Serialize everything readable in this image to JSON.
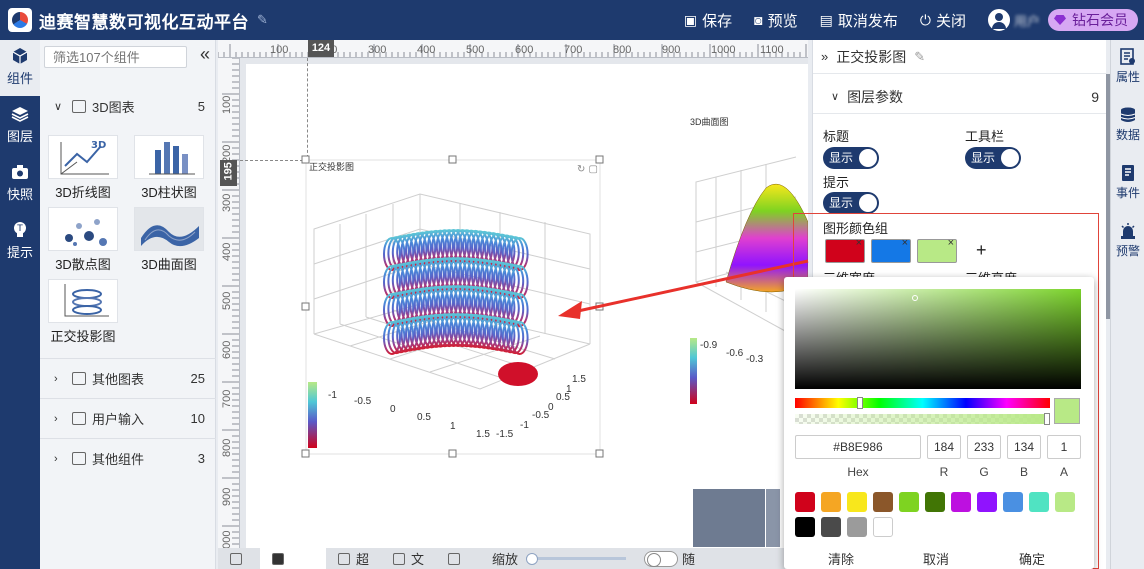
{
  "app": {
    "title": "迪赛智慧数可视化互动平台",
    "actions": {
      "save": "保存",
      "preview": "预览",
      "unpublish": "取消发布",
      "close": "关闭"
    },
    "user": {
      "name": "用户",
      "vip_label": "钻石会员"
    }
  },
  "leftnav": {
    "items": [
      {
        "label": "组件"
      },
      {
        "label": "图层"
      },
      {
        "label": "快照"
      },
      {
        "label": "提示"
      }
    ]
  },
  "components": {
    "search_placeholder": "筛选107个组件",
    "collapse_glyph": "«",
    "category_3d": {
      "name": "3D图表",
      "count": "5"
    },
    "items": [
      {
        "label": "3D折线图"
      },
      {
        "label": "3D柱状图"
      },
      {
        "label": "3D散点图"
      },
      {
        "label": "3D曲面图"
      },
      {
        "label": "正交投影图"
      }
    ],
    "other_categories": [
      {
        "name": "其他图表",
        "count": "25"
      },
      {
        "name": "用户输入",
        "count": "10"
      },
      {
        "name": "其他组件",
        "count": "3"
      }
    ]
  },
  "rulers": {
    "top_ticks": [
      "100",
      "200",
      "300",
      "400",
      "500",
      "600",
      "700",
      "800",
      "900",
      "1000",
      "1100"
    ],
    "left_ticks": [
      "100",
      "200",
      "300",
      "400",
      "500",
      "600",
      "700",
      "800",
      "900",
      "1000"
    ],
    "top_marker": "124",
    "left_marker": "195"
  },
  "canvas": {
    "chart1": {
      "title": "正交投影图",
      "x_ticks": [
        "-1",
        "-0.5",
        "0",
        "0.5",
        "1",
        "1.5"
      ],
      "y_ticks": [
        "-1.5",
        "-1",
        "-0.5",
        "0",
        "0.5",
        "1",
        "1.5"
      ]
    },
    "chart2": {
      "title": "3D曲面图",
      "x_ticks": [
        "-0.9",
        "-0.6",
        "-0.3"
      ]
    }
  },
  "bottombar": {
    "tab2": "超",
    "tab3": "文",
    "zoom_label": "缩放",
    "snap_label": "随"
  },
  "properties": {
    "header": "正交投影图",
    "section": {
      "title": "图层参数",
      "count": "9"
    },
    "title_label": "标题",
    "toolbar_label": "工具栏",
    "tooltip_label": "提示",
    "toggle_text": "显示",
    "color_group_label": "图形颜色组",
    "width_label": "三维宽度",
    "height_label": "三维高度",
    "add_glyph": "+",
    "colors": [
      "#d0021b",
      "#1478e6",
      "#b8e986"
    ]
  },
  "rightnav": {
    "items": [
      {
        "label": "属性"
      },
      {
        "label": "数据"
      },
      {
        "label": "事件"
      },
      {
        "label": "预警"
      }
    ]
  },
  "color_picker": {
    "hex": "#B8E986",
    "r": "184",
    "g": "233",
    "b": "134",
    "a": "1",
    "labels": {
      "hex": "Hex",
      "r": "R",
      "g": "G",
      "b": "B",
      "a": "A"
    },
    "presets": [
      "#d0021b",
      "#f5a623",
      "#f8e71c",
      "#8b572a",
      "#7ed321",
      "#417505",
      "#bd10e0",
      "#9013fe",
      "#4a90e2",
      "#50e3c2",
      "#b8e986",
      "#000000",
      "#4a4a4a",
      "#9b9b9b",
      "#ffffff"
    ],
    "clear": "清除",
    "cancel": "取消",
    "confirm": "确定"
  }
}
